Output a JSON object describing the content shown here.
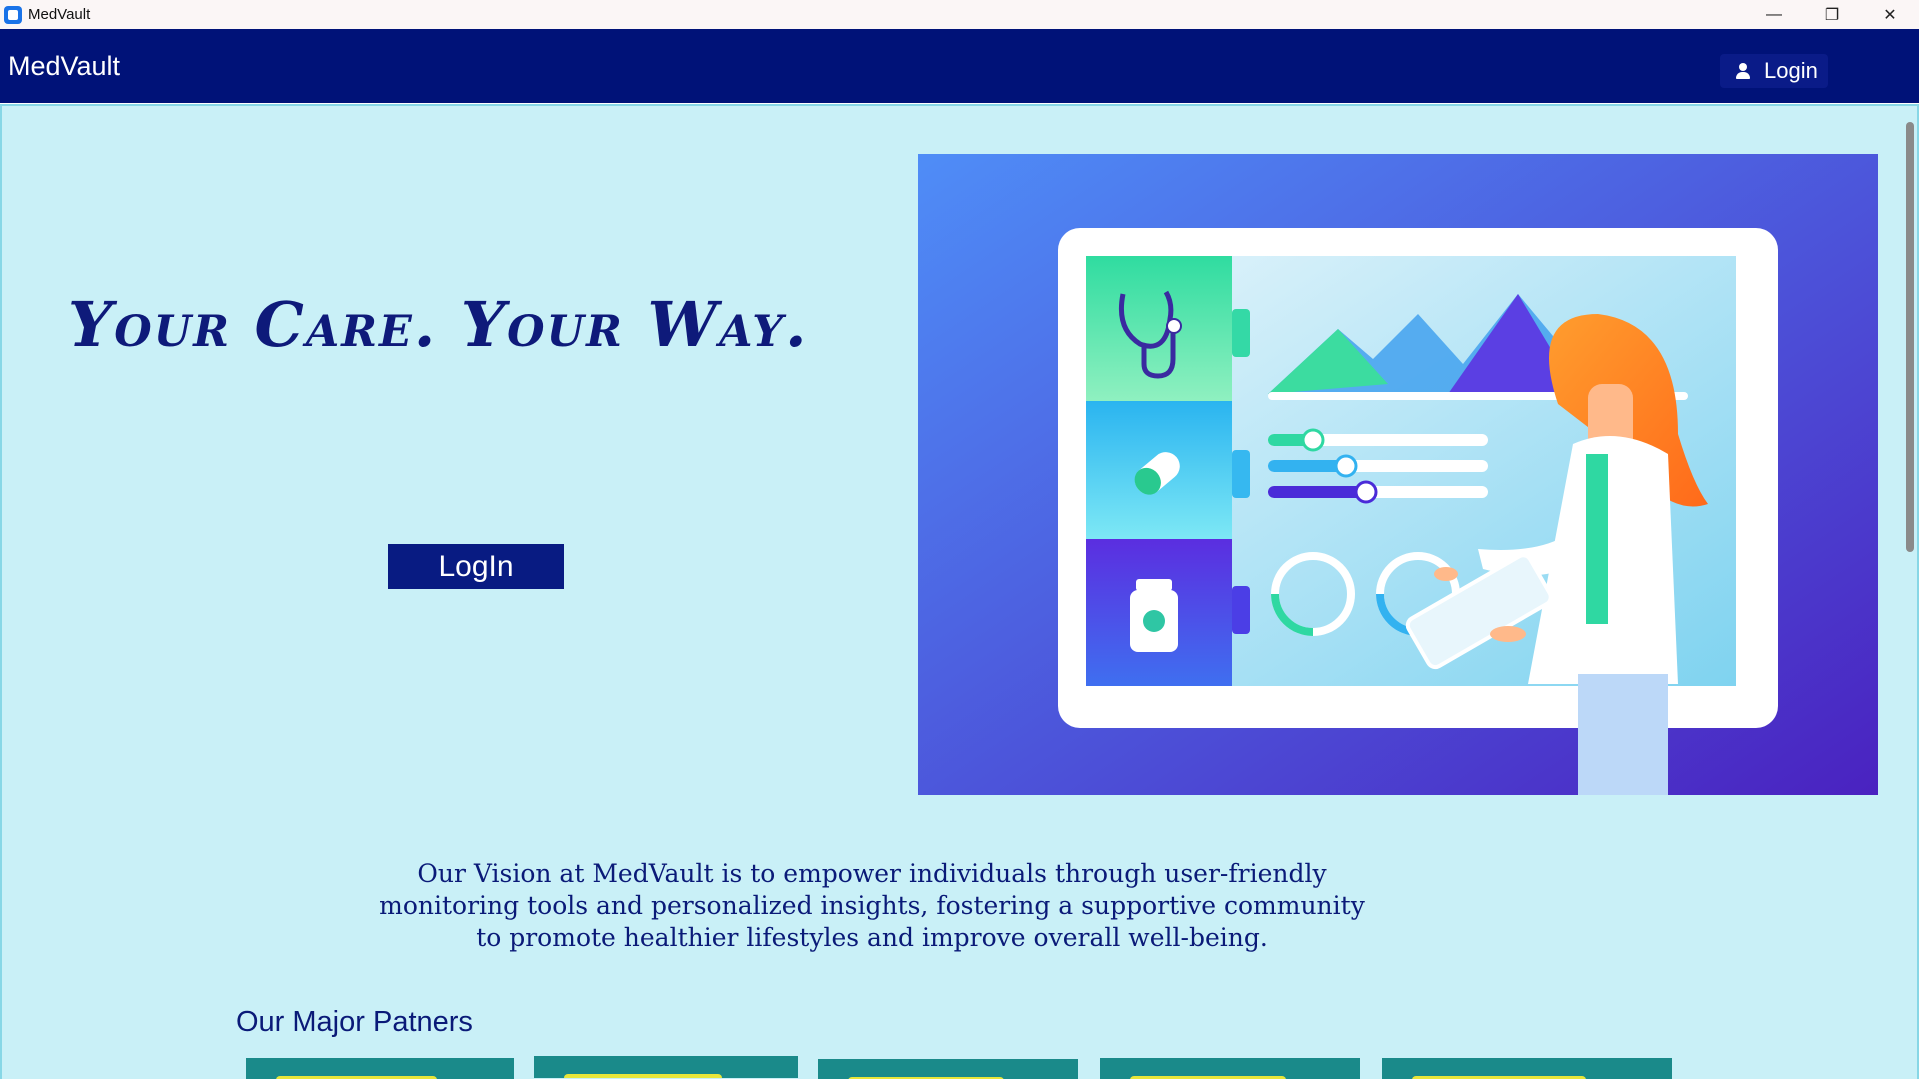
{
  "window": {
    "title": "MedVault",
    "controls": {
      "minimize": "—",
      "maximize": "❐",
      "close": "✕"
    }
  },
  "header": {
    "brand": "MedVault",
    "login_label": "Login",
    "login_icon": "user-icon"
  },
  "hero": {
    "tagline": "Your Care. Your Way.",
    "login_button": "LogIn",
    "illustration": "doctor-with-tablet-dashboard"
  },
  "vision": {
    "line1": "Our Vision at MedVault is to empower individuals through user-friendly",
    "line2": "monitoring tools and personalized insights, fostering a supportive community",
    "line3": "to promote healthier lifestyles and improve overall well-being."
  },
  "partners": {
    "title": "Our Major Patners",
    "count": 5
  },
  "colors": {
    "nav": "#001278",
    "background": "#c9f0f7",
    "accent": "#081b82",
    "text": "#0a1a78"
  }
}
